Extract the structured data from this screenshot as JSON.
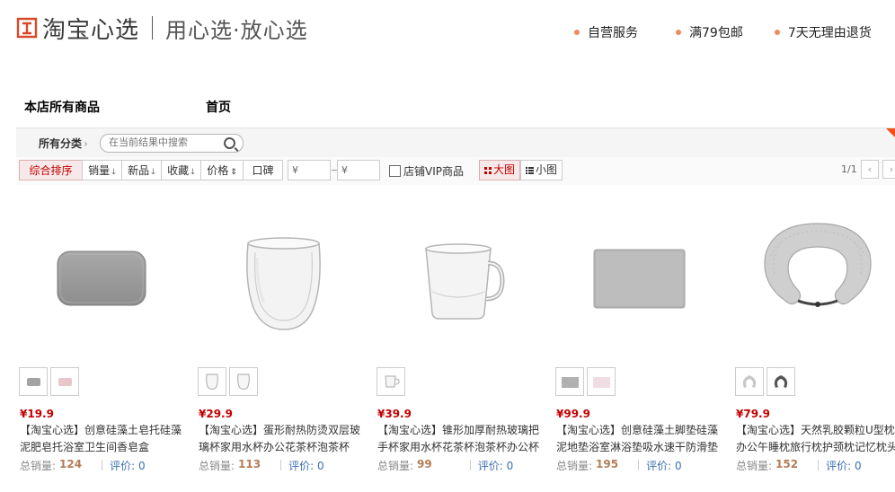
{
  "header": {
    "brand": "淘宝心选",
    "slogan": "用心选·放心选",
    "services": [
      "自营服务",
      "满79包邮",
      "7天无理由退货"
    ]
  },
  "shop_nav": [
    "本店所有商品",
    "首页"
  ],
  "category_bar": {
    "label": "所有分类",
    "search_placeholder": "在当前结果中搜索"
  },
  "sort_bar": {
    "default_sort": "综合排序",
    "sales": "销量",
    "new": "新品",
    "fav": "收藏",
    "price": "价格",
    "reputation": "口碑",
    "price_min_placeholder": "¥",
    "price_max_placeholder": "¥",
    "vip": "店铺VIP商品",
    "view_large": "大图",
    "view_small": "小图",
    "page": "1/1"
  },
  "products": [
    {
      "price": "¥19.9",
      "title": "【淘宝心选】创意硅藻土皂托硅藻泥肥皂托浴室卫生间香皂盒",
      "sales_label": "总销量:",
      "sales": "124",
      "review": "评价: 0",
      "thumb_colors": [
        "#a3a3a3",
        "#e8c6c9"
      ]
    },
    {
      "price": "¥29.9",
      "title": "【淘宝心选】蛋形耐热防烫双层玻璃杯家用水杯办公花茶杯泡茶杯",
      "sales_label": "总销量:",
      "sales": "113",
      "review": "评价: 0",
      "thumb_colors": [
        "#e6e6e6",
        "#e6e6e6"
      ]
    },
    {
      "price": "¥39.9",
      "title": "【淘宝心选】锥形加厚耐热玻璃把手杯家用水杯花茶杯泡茶杯办公杯",
      "sales_label": "总销量:",
      "sales": "99",
      "review": "评价: 0",
      "thumb_colors": [
        "#e6e6e6"
      ]
    },
    {
      "price": "¥99.9",
      "title": "【淘宝心选】创意硅藻土脚垫硅藻泥地垫浴室淋浴垫吸水速干防滑垫",
      "sales_label": "总销量:",
      "sales": "195",
      "review": "评价: 0",
      "thumb_colors": [
        "#b0b0b0",
        "#f0dde3"
      ]
    },
    {
      "price": "¥79.9",
      "title": "【淘宝心选】天然乳胶颗粒U型枕办公午睡枕旅行枕护颈枕记忆枕头",
      "sales_label": "总销量:",
      "sales": "152",
      "review": "评价: 0",
      "thumb_colors": [
        "#c8c8c8",
        "#555555"
      ]
    }
  ],
  "colors": {
    "accent": "#c40000",
    "dot": "#f08a5d",
    "review": "#3b6fb0",
    "sales": "#b57c55"
  }
}
